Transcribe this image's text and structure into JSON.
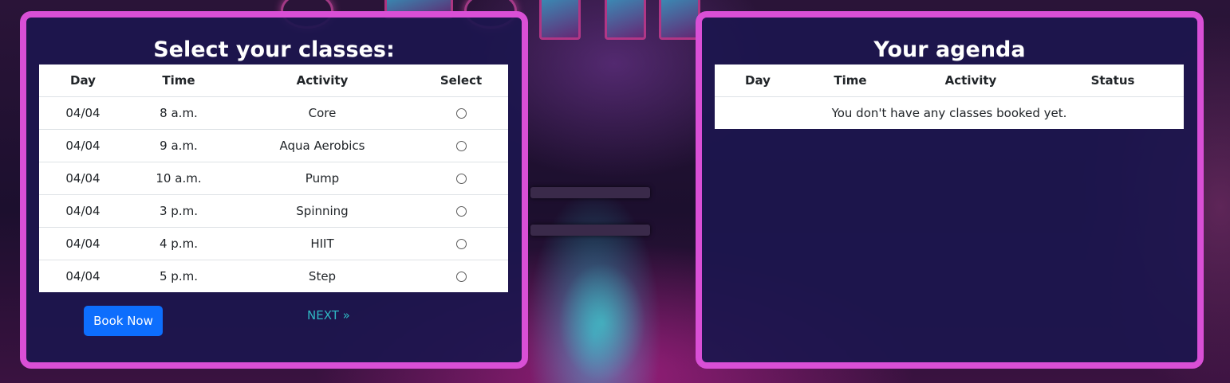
{
  "classes_panel": {
    "title": "Select your classes:",
    "columns": [
      "Day",
      "Time",
      "Activity",
      "Select"
    ],
    "rows": [
      {
        "day": "04/04",
        "time": "8 a.m.",
        "activity": "Core"
      },
      {
        "day": "04/04",
        "time": "9 a.m.",
        "activity": "Aqua Aerobics"
      },
      {
        "day": "04/04",
        "time": "10 a.m.",
        "activity": "Pump"
      },
      {
        "day": "04/04",
        "time": "3 p.m.",
        "activity": "Spinning"
      },
      {
        "day": "04/04",
        "time": "4 p.m.",
        "activity": "HIIT"
      },
      {
        "day": "04/04",
        "time": "5 p.m.",
        "activity": "Step"
      }
    ],
    "book_button_label": "Book Now",
    "next_link_label": "NEXT »"
  },
  "agenda_panel": {
    "title": "Your agenda",
    "columns": [
      "Day",
      "Time",
      "Activity",
      "Status"
    ],
    "empty_message": "You don't have any classes booked yet."
  },
  "colors": {
    "panel_border": "#d94fd6",
    "panel_background": "#1c164e",
    "button": "#0d6efd",
    "link": "#2fb7c3"
  }
}
